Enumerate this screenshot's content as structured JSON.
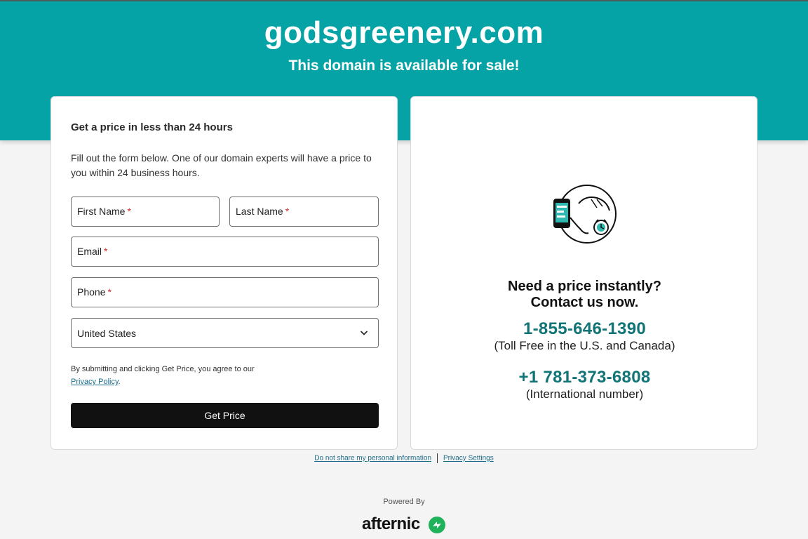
{
  "header": {
    "domain": "godsgreenery.com",
    "subtitle": "This domain is available for sale!",
    "bg_color": "#06a3a6"
  },
  "form": {
    "heading": "Get a price in less than 24 hours",
    "description": "Fill out the form below. One of our domain experts will have a price to you within 24 business hours.",
    "first_name_label": "First Name",
    "last_name_label": "Last Name",
    "email_label": "Email",
    "phone_label": "Phone",
    "required_mark": "*",
    "country_value": "United States",
    "consent_text": "By submitting and clicking Get Price, you agree to our",
    "privacy_link": "Privacy Policy",
    "consent_end": ".",
    "submit_label": "Get Price"
  },
  "contact": {
    "heading_line1": "Need a price instantly?",
    "heading_line2": "Contact us now.",
    "phone1": "1-855-646-1390",
    "phone1_note": "(Toll Free in the U.S. and Canada)",
    "phone2": "+1 781-373-6808",
    "phone2_note": "(International number)",
    "illustration_icon": "phone-support-icon",
    "phone_color": "#117476"
  },
  "footer": {
    "do_not_share": "Do not share my personal information",
    "privacy_settings": "Privacy Settings",
    "powered_by": "Powered By",
    "brand": "afternic",
    "brand_icon": "afternic-logo-icon",
    "brand_color": "#1fb25a"
  }
}
